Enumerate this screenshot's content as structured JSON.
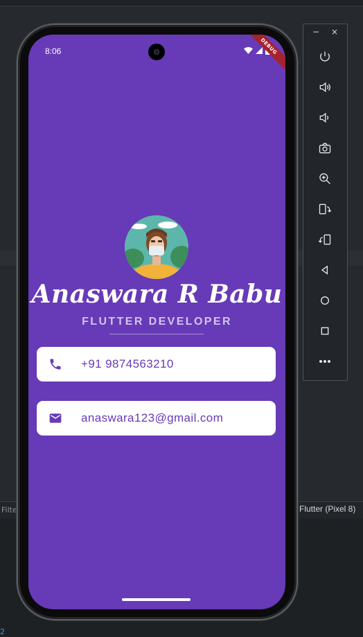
{
  "ide": {
    "filter_text": "Filte",
    "device_label": "Flutter (Pixel 8)",
    "line_number": "2"
  },
  "statusbar": {
    "time": "8:06",
    "debug_banner": "DEBUG"
  },
  "profile": {
    "name": "Anaswara R Babu",
    "title": "FLUTTER DEVELOPER",
    "phone": "+91 9874563210",
    "email": "anaswara123@gmail.com"
  },
  "icons": {
    "phone": "phone-icon",
    "email": "email-icon",
    "avatar": "avatar-illustration"
  },
  "emulator": {
    "minimize": "−",
    "close": "×",
    "buttons": [
      "power-icon",
      "volume-up-icon",
      "volume-down-icon",
      "camera-icon",
      "zoom-in-icon",
      "rotate-left-icon",
      "rotate-right-icon",
      "back-icon",
      "home-icon",
      "overview-icon",
      "more-icon"
    ]
  },
  "colors": {
    "primary": "#673ab7",
    "card": "#ffffff",
    "subtitle": "#d3c4ee",
    "debug": "#a4232f"
  }
}
